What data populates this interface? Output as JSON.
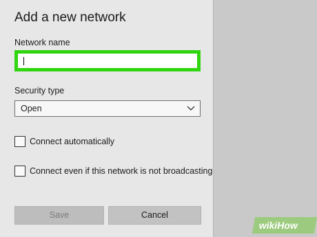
{
  "dialog": {
    "title": "Add a new network",
    "network_name": {
      "label": "Network name",
      "value": ""
    },
    "security_type": {
      "label": "Security type",
      "selected": "Open"
    },
    "connect_automatically": {
      "label": "Connect automatically",
      "checked": false
    },
    "connect_not_broadcasting": {
      "label": "Connect even if this network is not broadcasting",
      "checked": false
    },
    "buttons": {
      "save": "Save",
      "cancel": "Cancel"
    }
  },
  "watermark": "wikiHow",
  "colors": {
    "highlight": "#2fd60f",
    "dialog_bg": "#e7e7e7",
    "backdrop": "#c9c9c9"
  },
  "icons": {
    "dropdown": "chevron-down-icon",
    "checkbox": "checkbox-icon"
  }
}
